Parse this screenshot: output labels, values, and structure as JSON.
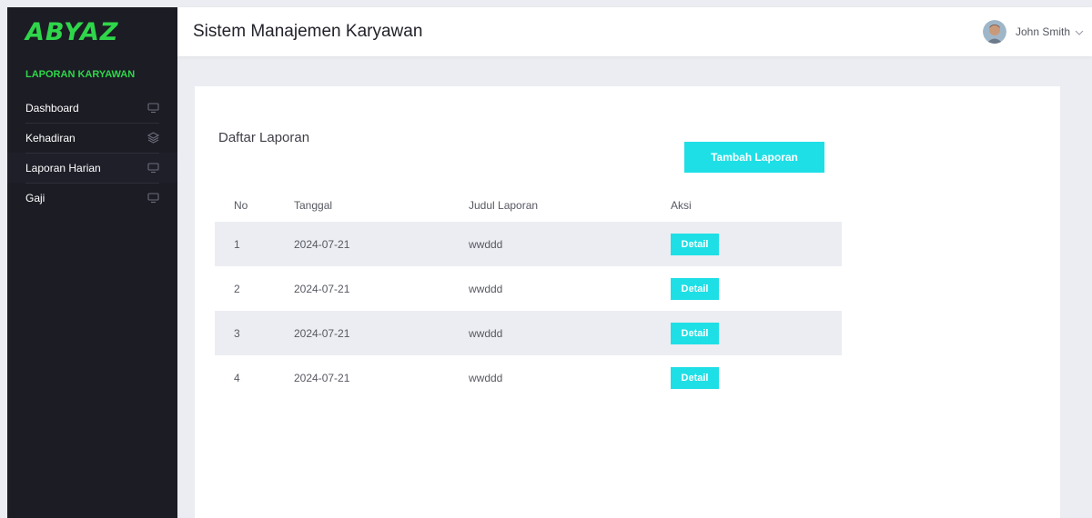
{
  "sidebar": {
    "logo": "ABYAZ",
    "section_title": "LAPORAN KARYAWAN",
    "items": [
      {
        "label": "Dashboard",
        "icon": "monitor-icon"
      },
      {
        "label": "Kehadiran",
        "icon": "layers-icon"
      },
      {
        "label": "Laporan Harian",
        "icon": "monitor-icon"
      },
      {
        "label": "Gaji",
        "icon": "monitor-icon"
      }
    ]
  },
  "header": {
    "title": "Sistem Manajemen Karyawan",
    "user_name": "John Smith"
  },
  "main": {
    "card_title": "Daftar Laporan",
    "add_button": "Tambah Laporan",
    "table": {
      "columns": [
        "No",
        "Tanggal",
        "Judul Laporan",
        "Aksi"
      ],
      "rows": [
        {
          "no": "1",
          "tanggal": "2024-07-21",
          "judul": "wwddd",
          "action": "Detail"
        },
        {
          "no": "2",
          "tanggal": "2024-07-21",
          "judul": "wwddd",
          "action": "Detail"
        },
        {
          "no": "3",
          "tanggal": "2024-07-21",
          "judul": "wwddd",
          "action": "Detail"
        },
        {
          "no": "4",
          "tanggal": "2024-07-21",
          "judul": "wwddd",
          "action": "Detail"
        }
      ]
    }
  },
  "colors": {
    "brand_green": "#2fd64a",
    "accent_cyan": "#1edfe6",
    "sidebar_bg": "#1c1c25"
  }
}
